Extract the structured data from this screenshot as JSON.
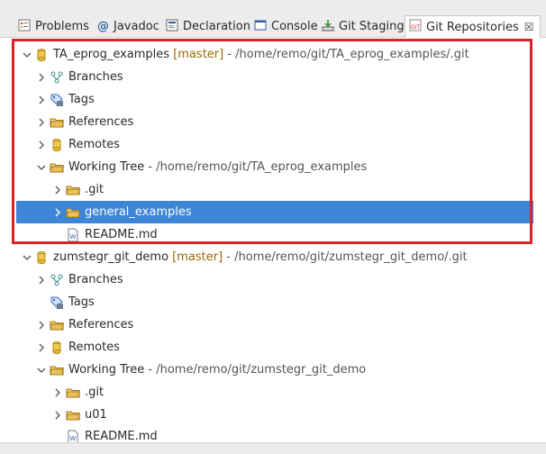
{
  "tabs": [
    {
      "label": "Problems",
      "icon": "problems-icon"
    },
    {
      "label": "Javadoc",
      "icon": "javadoc-icon"
    },
    {
      "label": "Declaration",
      "icon": "declaration-icon"
    },
    {
      "label": "Console",
      "icon": "console-icon"
    },
    {
      "label": "Git Staging",
      "icon": "git-staging-icon"
    },
    {
      "label": "Git Repositories",
      "icon": "git-repositories-icon",
      "close": "☒"
    }
  ],
  "repo1": {
    "name": "TA_eprog_examples",
    "branch": "[master]",
    "path": " - /home/remo/git/TA_eprog_examples/.git",
    "branches": "Branches",
    "tags": "Tags",
    "references": "References",
    "remotes": "Remotes",
    "working_tree": "Working Tree",
    "working_tree_path": " - /home/remo/git/TA_eprog_examples",
    "children": [
      ".git",
      "general_examples",
      "README.md"
    ]
  },
  "repo2": {
    "name": "zumstegr_git_demo",
    "branch": "[master]",
    "path": " - /home/remo/git/zumstegr_git_demo/.git",
    "branches": "Branches",
    "tags": "Tags",
    "references": "References",
    "remotes": "Remotes",
    "working_tree": "Working Tree",
    "working_tree_path": " - /home/remo/git/zumstegr_git_demo",
    "children": [
      ".git",
      "u01",
      "README.md"
    ]
  },
  "colors": {
    "selection": "#3d86d6",
    "highlight_box": "#e0212b",
    "branch_text": "#9a6a00"
  }
}
